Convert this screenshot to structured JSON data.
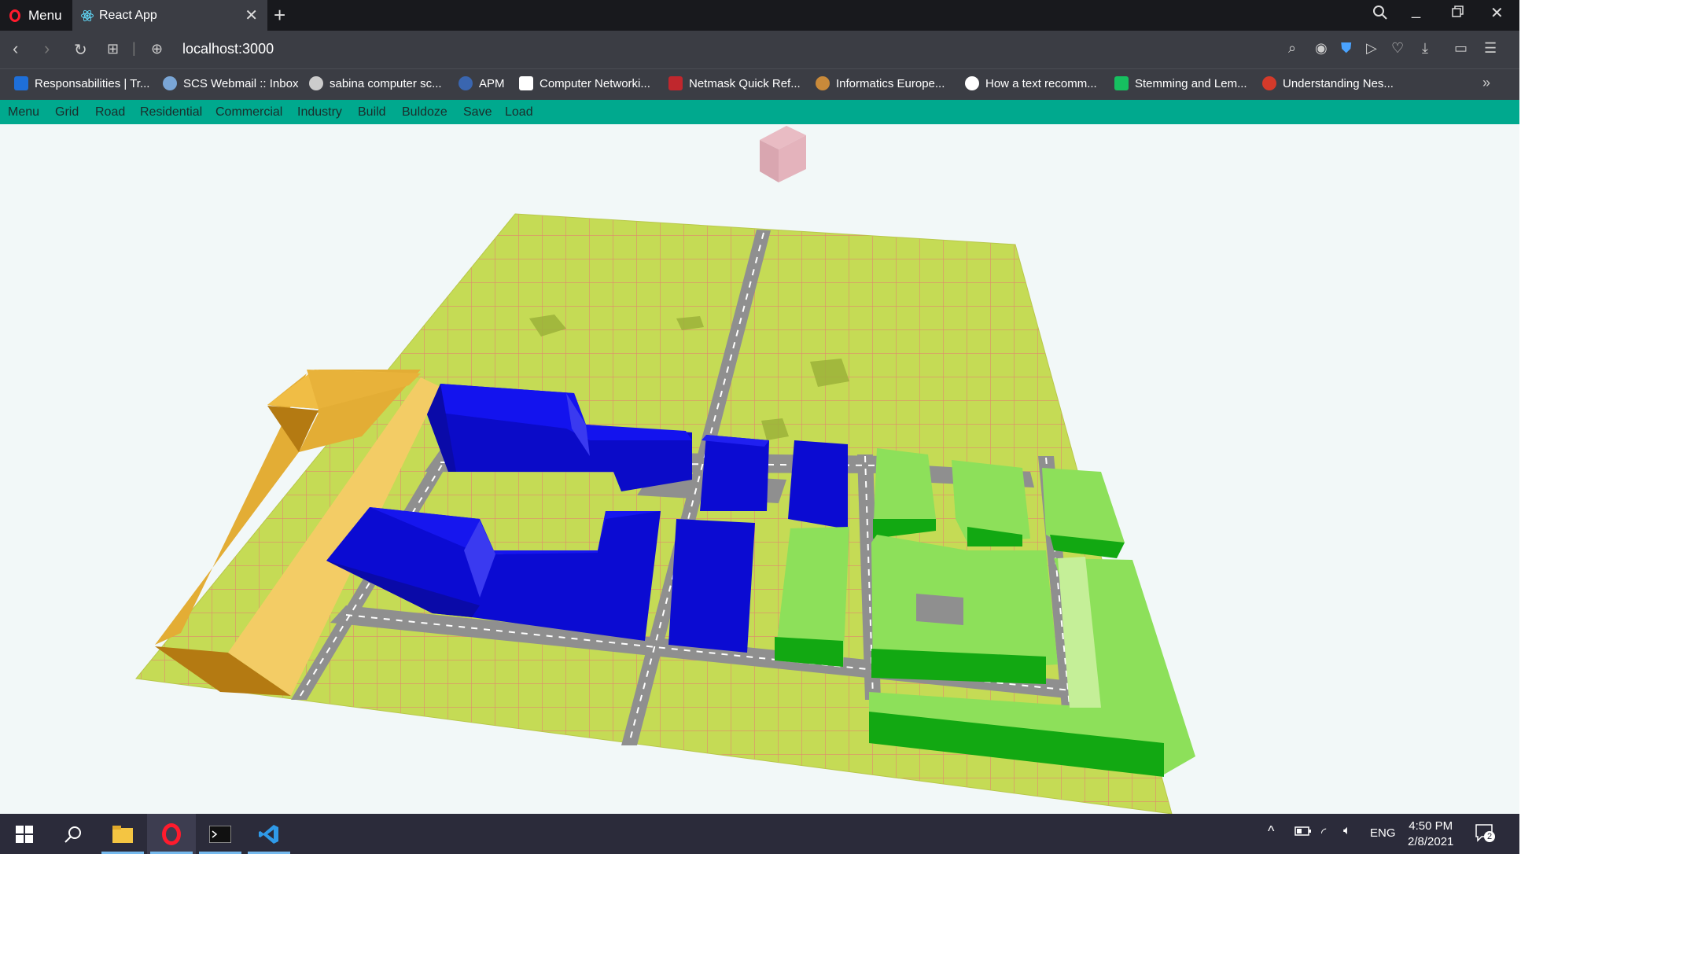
{
  "browser": {
    "menu_label": "Menu",
    "tab_title": "React App",
    "url": "localhost:3000"
  },
  "bookmarks": [
    {
      "label": "Responsabilities | Tr...",
      "color": "#1e6fd9"
    },
    {
      "label": "SCS Webmail :: Inbox",
      "color": "#7aa6d6"
    },
    {
      "label": "sabina computer sc...",
      "color": "#cccccc"
    },
    {
      "label": "APM",
      "color": "#3a66b0"
    },
    {
      "label": "Computer Networki...",
      "color": "#ffffff"
    },
    {
      "label": "Netmask Quick Ref...",
      "color": "#c0272d"
    },
    {
      "label": "Informatics Europe...",
      "color": "#c98a3a"
    },
    {
      "label": "How a text recomm...",
      "color": "#ffffff"
    },
    {
      "label": "Stemming and Lem...",
      "color": "#16c060"
    },
    {
      "label": "Understanding Nes...",
      "color": "#d43a2a"
    }
  ],
  "app_menu": [
    "Menu",
    "Grid",
    "Road",
    "Residential",
    "Commercial",
    "Industry",
    "Build",
    "Buldoze",
    "Save",
    "Load"
  ],
  "colors": {
    "accent": "#00a98e",
    "grass": "#c5db55",
    "road": "#8f8f8f",
    "commercial": "#0b0be0",
    "residential": "#8de05a",
    "industry": "#f0bd45"
  },
  "taskbar": {
    "apps": [
      "start-icon",
      "search-icon",
      "file-explorer-icon",
      "opera-icon",
      "terminal-icon",
      "vscode-icon"
    ],
    "language": "ENG",
    "time": "4:50 PM",
    "date": "2/8/2021",
    "notifications": "2"
  }
}
